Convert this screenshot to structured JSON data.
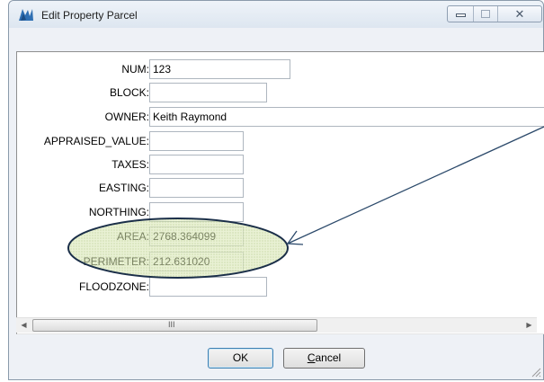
{
  "window": {
    "title": "Edit Property Parcel",
    "buttons": {
      "minimize": "minimize",
      "maximize": "maximize",
      "close": "close"
    }
  },
  "form": {
    "fields": [
      {
        "label": "NUM:",
        "value": "123"
      },
      {
        "label": "BLOCK:",
        "value": ""
      },
      {
        "label": "OWNER:",
        "value": "Keith Raymond"
      },
      {
        "label": "APPRAISED_VALUE:",
        "value": ""
      },
      {
        "label": "TAXES:",
        "value": ""
      },
      {
        "label": "EASTING:",
        "value": ""
      },
      {
        "label": "NORTHING:",
        "value": ""
      },
      {
        "label": "AREA:",
        "value": "2768.364099"
      },
      {
        "label": "PERIMETER:",
        "value": "212.631020"
      },
      {
        "label": "FLOODZONE:",
        "value": ""
      }
    ]
  },
  "scrollbar": {
    "grip": "III",
    "left_arrow": "◀",
    "right_arrow": "▶"
  },
  "footer": {
    "ok_label": "OK",
    "cancel_label": "Cancel"
  },
  "annotation": {
    "highlight_color": "#c9dc9a",
    "outline_color": "#1b2f49"
  },
  "icons": [
    "app-icon",
    "minimize-icon",
    "maximize-icon",
    "close-icon",
    "resize-grip-icon"
  ]
}
